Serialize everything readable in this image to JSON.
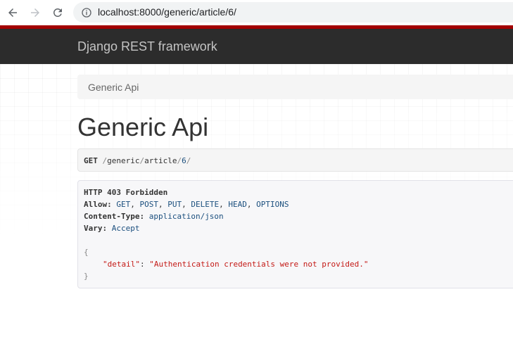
{
  "browser": {
    "url": "localhost:8000/generic/article/6/"
  },
  "navbar": {
    "brand": "Django REST framework"
  },
  "breadcrumb": {
    "items": [
      "Generic Api"
    ]
  },
  "page": {
    "title": "Generic Api"
  },
  "request": {
    "method": "GET",
    "path_parts": [
      "/",
      "generic",
      "/",
      "article",
      "/",
      "6",
      "/"
    ]
  },
  "response": {
    "status": "HTTP 403 Forbidden",
    "headers": [
      {
        "name": "Allow:",
        "values": [
          "GET",
          "POST",
          "PUT",
          "DELETE",
          "HEAD",
          "OPTIONS"
        ]
      },
      {
        "name": "Content-Type:",
        "values": [
          "application/json"
        ]
      },
      {
        "name": "Vary:",
        "values": [
          "Accept"
        ]
      }
    ],
    "body": {
      "open": "{",
      "key": "\"detail\"",
      "colon": ":",
      "value": "\"Authentication credentials were not provided.\"",
      "close": "}"
    }
  },
  "colors": {
    "accent_red": "#a30000",
    "navbar_bg": "#2c2c2c",
    "link_blue": "#1b4f7e",
    "string_red": "#c41a16"
  }
}
